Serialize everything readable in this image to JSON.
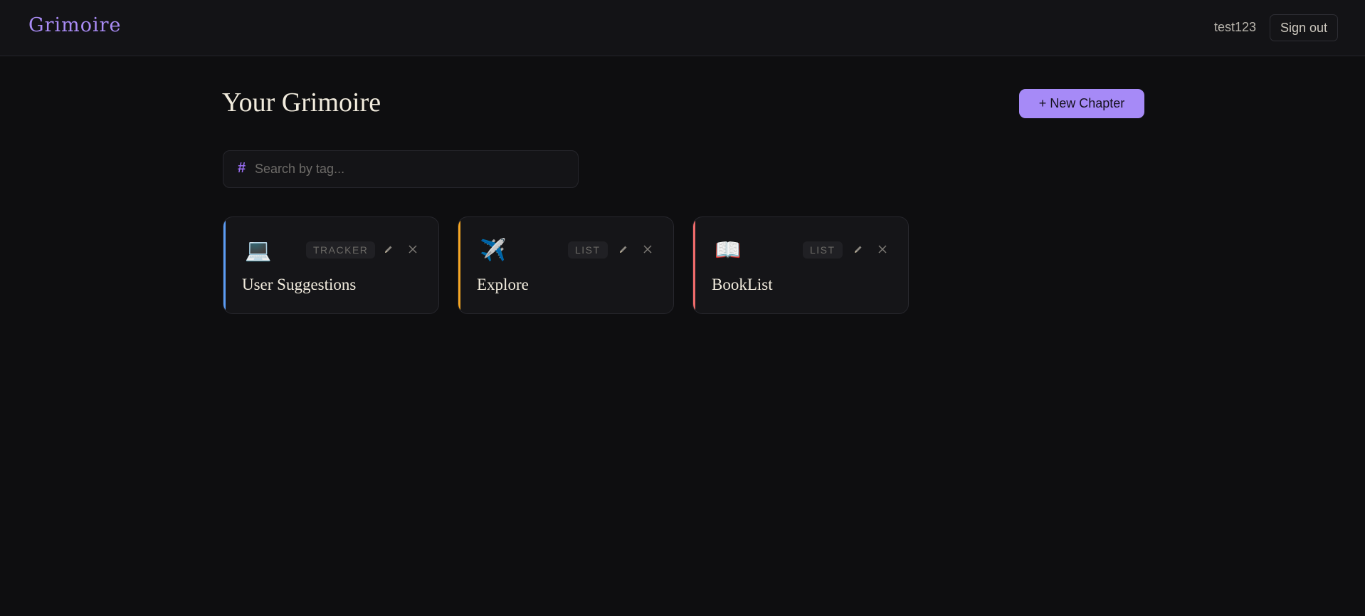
{
  "header": {
    "logo": "Grimoire",
    "username": "test123",
    "signout_label": "Sign out"
  },
  "main": {
    "title": "Your Grimoire",
    "new_chapter_label": "+ New Chapter",
    "search": {
      "icon": "#",
      "placeholder": "Search by tag...",
      "value": ""
    },
    "cards": [
      {
        "emoji": "💻",
        "type": "TRACKER",
        "title": "User Suggestions",
        "accent": "#5b9cf5"
      },
      {
        "emoji": "✈️",
        "type": "LIST",
        "title": "Explore",
        "accent": "#f5a623"
      },
      {
        "emoji": "📖",
        "type": "LIST",
        "title": "BookList",
        "accent": "#f06b6b"
      }
    ]
  },
  "colors": {
    "brand": "#a98bf5",
    "button": "#a68af7",
    "background": "#0e0e10"
  }
}
